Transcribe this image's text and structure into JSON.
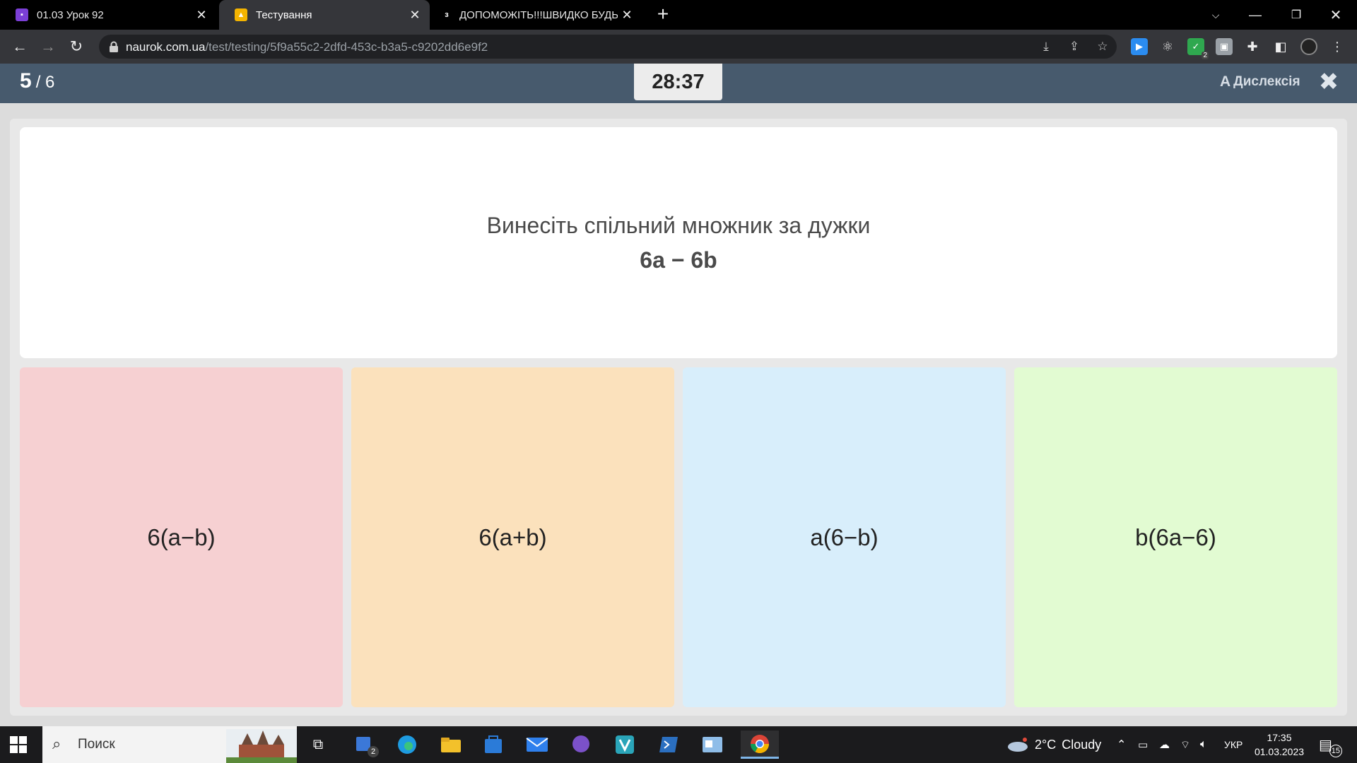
{
  "browser": {
    "tabs": [
      {
        "title": "01.03 Урок 92",
        "favicon": "classroom-icon",
        "favicon_color": "#7b3fd6"
      },
      {
        "title": "Тестування",
        "favicon": "naurok-icon",
        "favicon_color": "#f4b400",
        "active": true
      },
      {
        "title": "ДОПОМОЖІТЬ!!!ШВИДКО БУДЬ",
        "favicon": "znanija-icon",
        "favicon_color": "#000000"
      }
    ],
    "new_tab": "+",
    "address": {
      "host": "naurok.com.ua",
      "path": "/test/testing/5f9a55c2-2dfd-453c-b3a5-c9202dd6e9f2"
    },
    "extension_badge": "2"
  },
  "quiz": {
    "current": "5",
    "total": "/ 6",
    "timer": "28:37",
    "dyslexia_icon": "A",
    "dyslexia_label": "Дислексія",
    "close_symbol": "✖",
    "question_text": "Винесіть спільний множник за дужки",
    "question_expr": "6a − 6b",
    "options": [
      {
        "label": "6(a−b)",
        "color": "#f6d0d2"
      },
      {
        "label": "6(a+b)",
        "color": "#fbe1bc"
      },
      {
        "label": "a(6−b)",
        "color": "#d8eefb"
      },
      {
        "label": "b(6a−6)",
        "color": "#e2fbd2"
      }
    ]
  },
  "taskbar": {
    "search_placeholder": "Поиск",
    "store_badge": "2",
    "weather": {
      "temp": "2°C",
      "condition": "Cloudy"
    },
    "language": "УКР",
    "time": "17:35",
    "date": "01.03.2023",
    "notifications": "15"
  },
  "colors": {
    "header": "#475a6d",
    "accent": "#7fb6e8"
  }
}
